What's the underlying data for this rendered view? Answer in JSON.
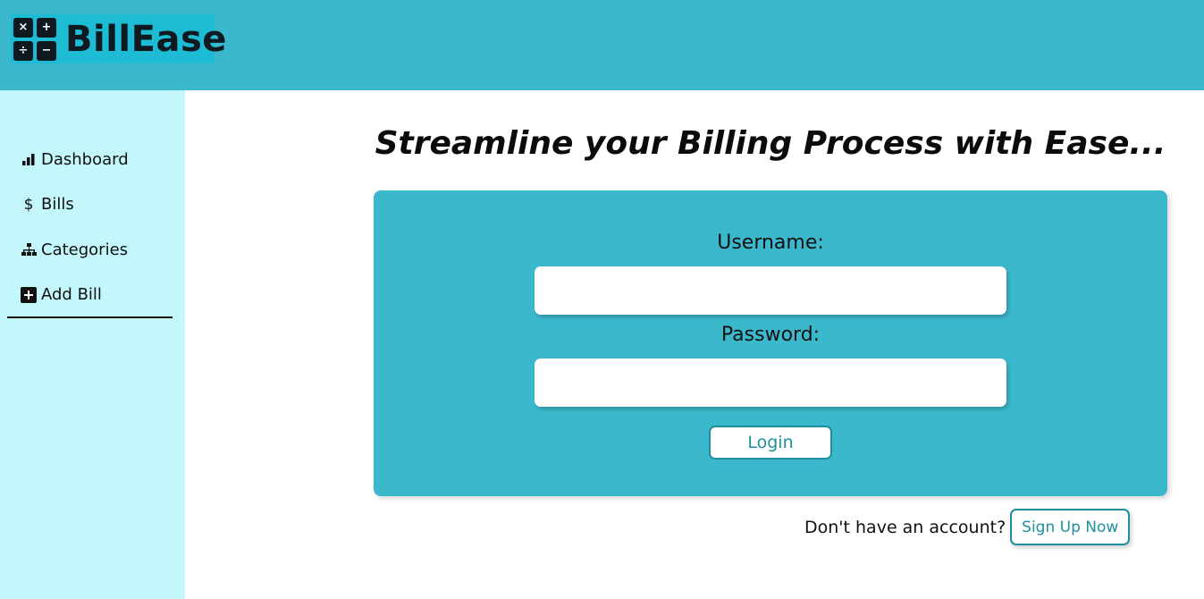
{
  "header": {
    "logo": {
      "symbols": [
        "×",
        "+",
        "÷",
        "−"
      ],
      "text": "BillEase"
    }
  },
  "sidebar": {
    "items": [
      {
        "label": "Dashboard",
        "icon": "bar-chart-icon"
      },
      {
        "label": "Bills",
        "icon": "dollar-icon"
      },
      {
        "label": "Categories",
        "icon": "sitemap-icon"
      },
      {
        "label": "Add Bill",
        "icon": "plus-square-icon"
      }
    ]
  },
  "main": {
    "hero": "Streamline your Billing Process with Ease...",
    "login": {
      "username_label": "Username:",
      "username_value": "",
      "password_label": "Password:",
      "password_value": "",
      "login_button": "Login"
    },
    "signup": {
      "prompt": "Don't have an account?",
      "button": "Sign Up Now"
    }
  },
  "colors": {
    "primary": "#3bb8cc",
    "sidebar_bg": "#c3f7fb",
    "accent_text": "#1f8f9f",
    "logo_bg": "#1dbcd4"
  }
}
